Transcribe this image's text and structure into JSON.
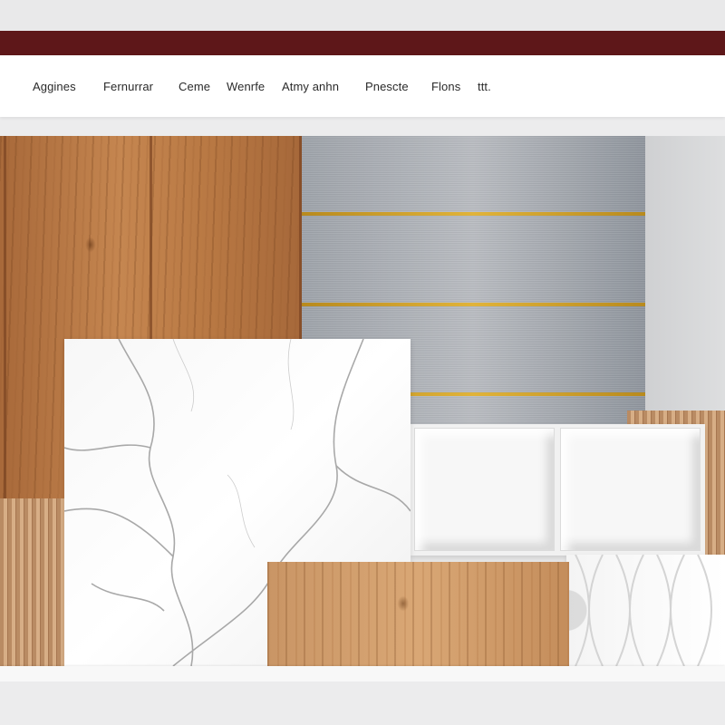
{
  "nav": {
    "items": [
      {
        "label": "Aggines"
      },
      {
        "label": "Fernurrar"
      },
      {
        "label": "Ceme"
      },
      {
        "label": "Wenrfe"
      },
      {
        "label": "Atmy anhn"
      },
      {
        "label": "Pnescte"
      },
      {
        "label": "Flons"
      },
      {
        "label": "ttt."
      }
    ]
  },
  "colors": {
    "brand_bar": "#5e1719",
    "accent_gold": "#d9aa32"
  },
  "swatches": [
    {
      "name": "wood-plank",
      "icon": "wood-texture"
    },
    {
      "name": "brushed-metal",
      "icon": "metal-texture"
    },
    {
      "name": "white-marble",
      "icon": "marble-texture"
    },
    {
      "name": "wood-slat",
      "icon": "slat-texture"
    },
    {
      "name": "white-bevel-tile",
      "icon": "tile-texture"
    },
    {
      "name": "light-wood",
      "icon": "wood-texture"
    },
    {
      "name": "white-3d-panel",
      "icon": "panel-texture"
    }
  ]
}
